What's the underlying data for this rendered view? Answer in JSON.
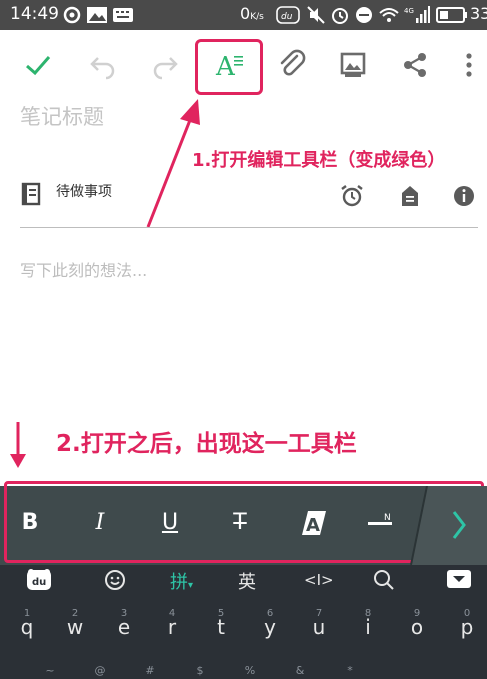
{
  "status_bar": {
    "time": "14:49",
    "net_speed": "0",
    "net_unit": "K/s",
    "battery": "33"
  },
  "toolbar": {
    "icons": [
      "check-icon",
      "undo-icon",
      "redo-icon",
      "font-format-icon",
      "paperclip-icon",
      "image-icon",
      "share-icon",
      "more-vert-icon"
    ],
    "accent": "#2db46e"
  },
  "note": {
    "title_placeholder": "笔记标题",
    "todo_label": "待做事项",
    "body_placeholder": "写下此刻的想法..."
  },
  "annotations": {
    "step1": "1.打开编辑工具栏（变成绿色）",
    "step2": "2.打开之后，出现这一工具栏",
    "color": "#e0245e"
  },
  "format_bar": {
    "bold": "B",
    "italic": "I",
    "underline": "U",
    "strike": "T",
    "highlight": "A",
    "icons": [
      "bold-icon",
      "italic-icon",
      "underline-icon",
      "strikethrough-icon",
      "highlight-icon",
      "clear-format-icon",
      "chevron-right-icon"
    ]
  },
  "keyboard": {
    "toolbar": {
      "pinyin": "拼",
      "english": "英",
      "cursor": "<I>"
    },
    "row1_keys": [
      "q",
      "w",
      "e",
      "r",
      "t",
      "y",
      "u",
      "i",
      "o",
      "p"
    ],
    "row1_nums": [
      "1",
      "2",
      "3",
      "4",
      "5",
      "6",
      "7",
      "8",
      "9",
      "0"
    ],
    "row2_syms": [
      "~",
      "@",
      "#",
      "$",
      "%",
      "&",
      "*"
    ]
  }
}
